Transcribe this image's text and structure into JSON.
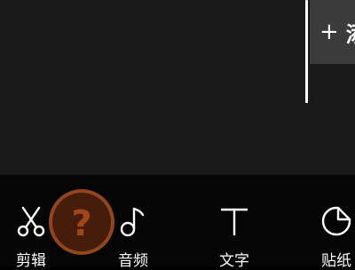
{
  "timeline": {
    "add_clip": {
      "icon": "plus-icon",
      "label": "+ 添"
    }
  },
  "toolbar": {
    "items": [
      {
        "id": "edit",
        "label": "剪辑",
        "icon": "scissors-icon"
      },
      {
        "id": "audio",
        "label": "音频",
        "icon": "music-note-icon"
      },
      {
        "id": "text",
        "label": "文字",
        "icon": "text-icon"
      },
      {
        "id": "sticker",
        "label": "贴纸",
        "icon": "sticker-icon"
      }
    ]
  },
  "overlay": {
    "help_symbol": "?",
    "icon": "help-icon"
  },
  "colors": {
    "timeline_bg": "#191919",
    "toolbar_bg": "#050505",
    "add_clip_bg": "#3b3b3b",
    "help_badge": "#d66826"
  }
}
